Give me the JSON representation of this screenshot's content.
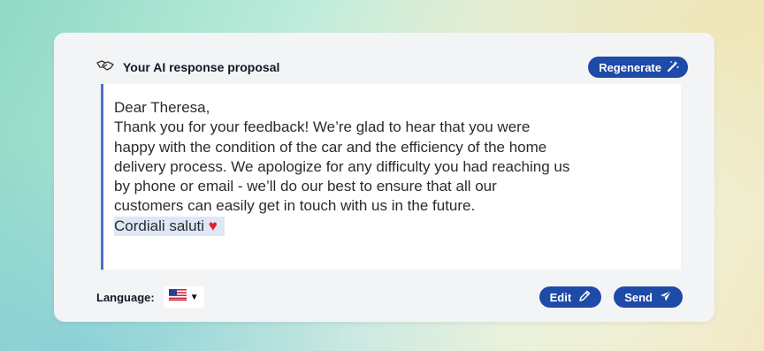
{
  "proposal": {
    "title": "Your AI response proposal",
    "regenerate_label": "Regenerate",
    "message_lines": [
      "Dear Theresa,",
      "Thank you for your feedback! We’re glad to hear that you were",
      "happy with the condition of the car and the efficiency of the home",
      "delivery process. We apologize for any difficulty you had reaching us",
      "by phone or email - we’ll do our best to ensure that all our",
      "customers can easily get in touch with us in the future."
    ],
    "signoff": "Cordiali saluti",
    "signoff_emoji": "♥"
  },
  "footer": {
    "language_label": "Language:",
    "language_flag": "us-flag-icon",
    "edit_label": "Edit",
    "send_label": "Send"
  },
  "colors": {
    "accent": "#1e4aa8",
    "quote_bar": "#4a72c8",
    "heart": "#e0202c"
  }
}
